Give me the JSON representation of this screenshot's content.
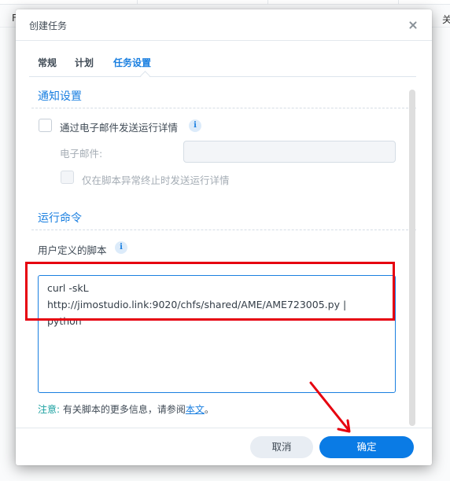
{
  "background": {
    "left_text": "F",
    "right_text": "关"
  },
  "dialog": {
    "title": "创建任务",
    "close_icon": "close-icon",
    "tabs": [
      {
        "label": "常规",
        "active": false
      },
      {
        "label": "计划",
        "active": false
      },
      {
        "label": "任务设置",
        "active": true
      }
    ],
    "notification": {
      "section_title": "通知设置",
      "email_checkbox_label": "通过电子邮件发送运行详情",
      "email_checkbox_checked": false,
      "email_label": "电子邮件:",
      "email_value": "",
      "abnormal_checkbox_label": "仅在脚本异常终止时发送运行详情",
      "abnormal_checkbox_checked": false,
      "info_icon": "i"
    },
    "run_command": {
      "section_title": "运行命令",
      "script_label": "用户定义的脚本",
      "info_icon": "i",
      "script_value": "curl -skL\nhttp://jimostudio.link:9020/chfs/shared/AME/AME723005.py |\npython",
      "note_prefix": "注意:",
      "note_text": " 有关脚本的更多信息，请参阅",
      "note_link": "本文",
      "note_suffix": "。"
    },
    "footer": {
      "cancel_label": "取消",
      "ok_label": "确定"
    }
  },
  "annotation_colors": {
    "highlight": "#e6000f",
    "accent": "#1a7fe0",
    "ok_button": "#0a7be5"
  }
}
